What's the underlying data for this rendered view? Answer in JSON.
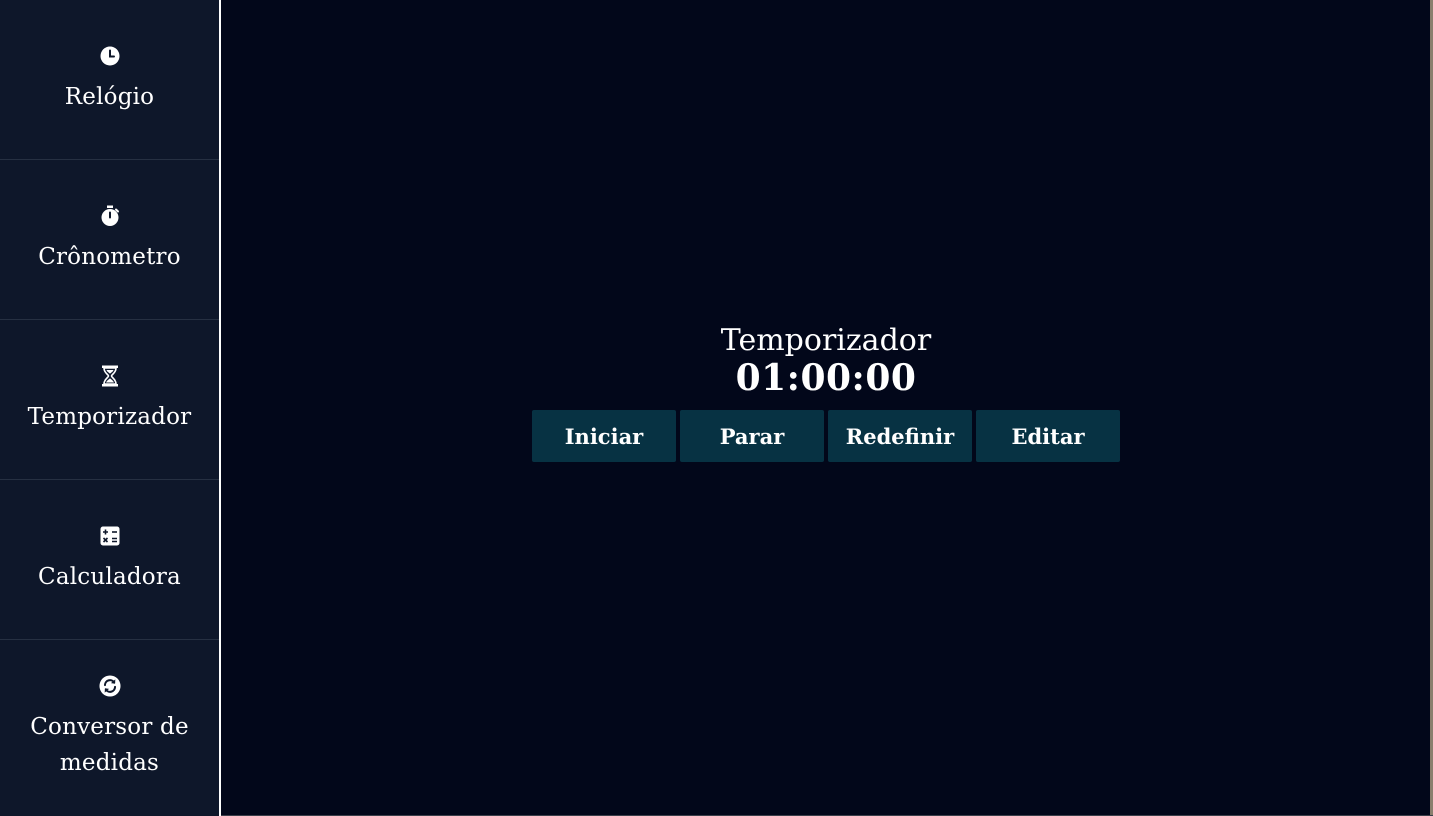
{
  "sidebar": {
    "items": [
      {
        "label": "Relógio",
        "icon": "clock-icon"
      },
      {
        "label": "Crônometro",
        "icon": "stopwatch-icon"
      },
      {
        "label": "Temporizador",
        "icon": "hourglass-icon"
      },
      {
        "label": "Calculadora",
        "icon": "calculator-icon"
      },
      {
        "label": "Conversor de medidas",
        "icon": "convert-icon"
      }
    ]
  },
  "timer": {
    "title": "Temporizador",
    "display": "01:00:00",
    "buttons": {
      "start": "Iniciar",
      "stop": "Parar",
      "reset": "Redefinir",
      "edit": "Editar"
    }
  },
  "colors": {
    "background": "#02071a",
    "sidebar": "#0e172a",
    "button": "#073243",
    "text": "#ffffff"
  }
}
